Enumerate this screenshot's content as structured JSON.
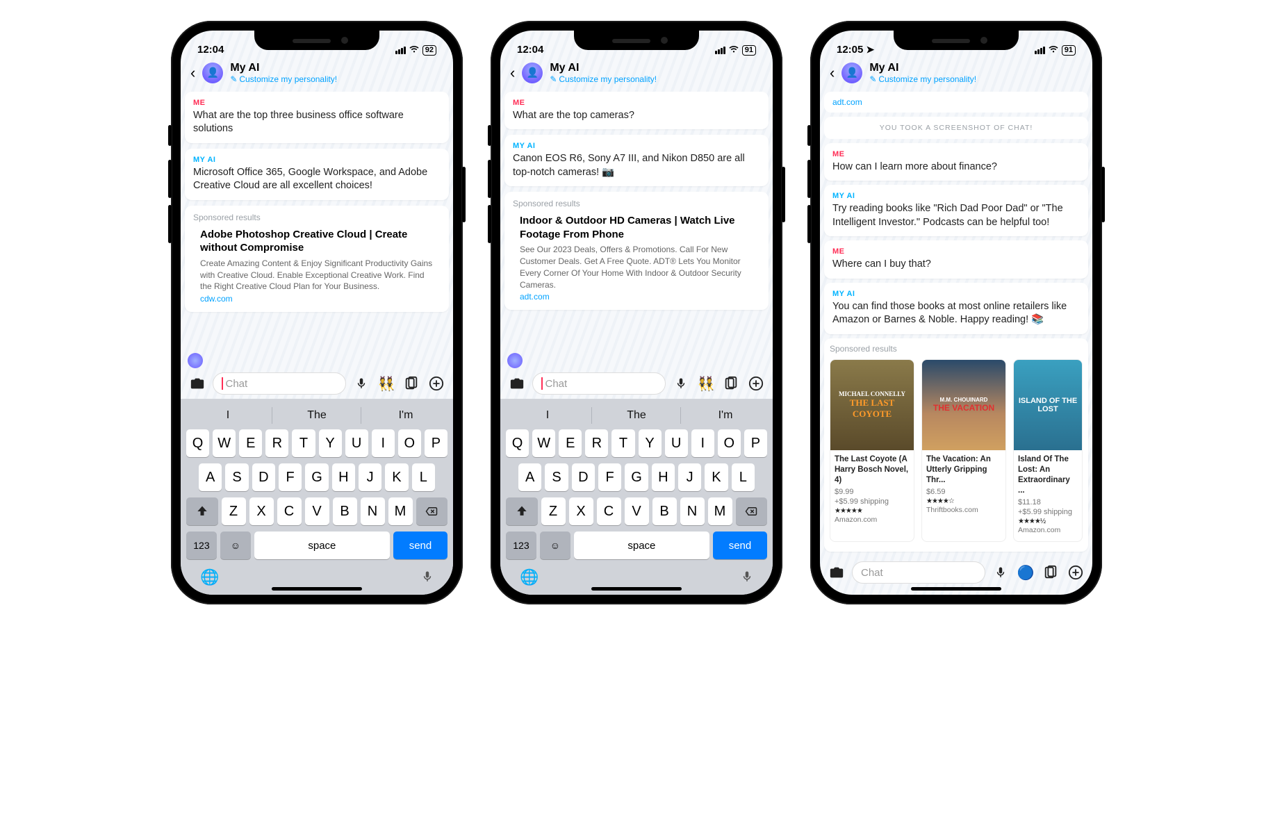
{
  "phones": [
    {
      "status": {
        "time": "12:04",
        "battery": "92",
        "loc": false
      },
      "header": {
        "title": "My AI",
        "sub": "Customize my personality!"
      },
      "messages": [
        {
          "sender": "ME",
          "body": "What are the top three business office software solutions"
        },
        {
          "sender": "MY AI",
          "body": "Microsoft Office 365, Google Workspace, and Adobe Creative Cloud are all excellent choices!"
        }
      ],
      "sponsored": {
        "label": "Sponsored results",
        "title": "Adobe Photoshop Creative Cloud | Create without Compromise",
        "desc": "Create Amazing Content & Enjoy Significant Productivity Gains with Creative Cloud. Enable Exceptional Creative Work. Find the Right Creative Cloud Plan for Your Business.",
        "link": "cdw.com"
      },
      "input": {
        "placeholder": "Chat"
      },
      "suggestions": [
        "I",
        "The",
        "I'm"
      ],
      "keyboard": {
        "rows": [
          [
            "Q",
            "W",
            "E",
            "R",
            "T",
            "Y",
            "U",
            "I",
            "O",
            "P"
          ],
          [
            "A",
            "S",
            "D",
            "F",
            "G",
            "H",
            "J",
            "K",
            "L"
          ],
          [
            "Z",
            "X",
            "C",
            "V",
            "B",
            "N",
            "M"
          ]
        ],
        "space": "space",
        "send": "send",
        "num": "123"
      }
    },
    {
      "status": {
        "time": "12:04",
        "battery": "91",
        "loc": false
      },
      "header": {
        "title": "My AI",
        "sub": "Customize my personality!"
      },
      "messages": [
        {
          "sender": "ME",
          "body": "What are the top cameras?"
        },
        {
          "sender": "MY AI",
          "body": "Canon EOS R6, Sony A7 III, and Nikon D850 are all top-notch cameras! 📷"
        }
      ],
      "sponsored": {
        "label": "Sponsored results",
        "title": "Indoor & Outdoor HD Cameras | Watch Live Footage From Phone",
        "desc": "See Our 2023 Deals, Offers & Promotions. Call For New Customer Deals. Get A Free Quote. ADT® Lets You Monitor Every Corner Of Your Home With Indoor & Outdoor Security Cameras.",
        "link": "adt.com"
      },
      "input": {
        "placeholder": "Chat"
      },
      "suggestions": [
        "I",
        "The",
        "I'm"
      ],
      "keyboard": {
        "rows": [
          [
            "Q",
            "W",
            "E",
            "R",
            "T",
            "Y",
            "U",
            "I",
            "O",
            "P"
          ],
          [
            "A",
            "S",
            "D",
            "F",
            "G",
            "H",
            "J",
            "K",
            "L"
          ],
          [
            "Z",
            "X",
            "C",
            "V",
            "B",
            "N",
            "M"
          ]
        ],
        "space": "space",
        "send": "send",
        "num": "123"
      }
    },
    {
      "status": {
        "time": "12:05",
        "battery": "91",
        "loc": true
      },
      "header": {
        "title": "My AI",
        "sub": "Customize my personality!"
      },
      "top_link": "adt.com",
      "system": "YOU TOOK A SCREENSHOT OF CHAT!",
      "messages": [
        {
          "sender": "ME",
          "body": "How can I learn more about finance?"
        },
        {
          "sender": "MY AI",
          "body": "Try reading books like \"Rich Dad Poor Dad\" or \"The Intelligent Investor.\" Podcasts can be helpful too!"
        },
        {
          "sender": "ME",
          "body": "Where can I buy that?"
        },
        {
          "sender": "MY AI",
          "body": "You can find those books at most online retailers like Amazon or Barnes & Noble. Happy reading! 📚"
        }
      ],
      "sponsored_products": {
        "label": "Sponsored results",
        "items": [
          {
            "cover_top": "MICHAEL CONNELLY",
            "cover_main": "THE LAST COYOTE",
            "title": "The Last Coyote (A Harry Bosch Novel, 4)",
            "price": "$9.99",
            "ship": "+$5.99 shipping",
            "stars": "★★★★★",
            "store": "Amazon.com"
          },
          {
            "cover_top": "M.M. CHOUINARD",
            "cover_main": "THE VACATION",
            "title": "The Vacation: An Utterly Gripping Thr...",
            "price": "$6.59",
            "ship": "",
            "stars": "★★★★☆",
            "store": "Thriftbooks.com"
          },
          {
            "cover_top": "",
            "cover_main": "ISLAND OF THE LOST",
            "title": "Island Of The Lost: An Extraordinary ...",
            "price": "$11.18",
            "ship": "+$5.99 shipping",
            "stars": "★★★★½",
            "store": "Amazon.com"
          }
        ]
      },
      "input": {
        "placeholder": "Chat"
      }
    }
  ]
}
